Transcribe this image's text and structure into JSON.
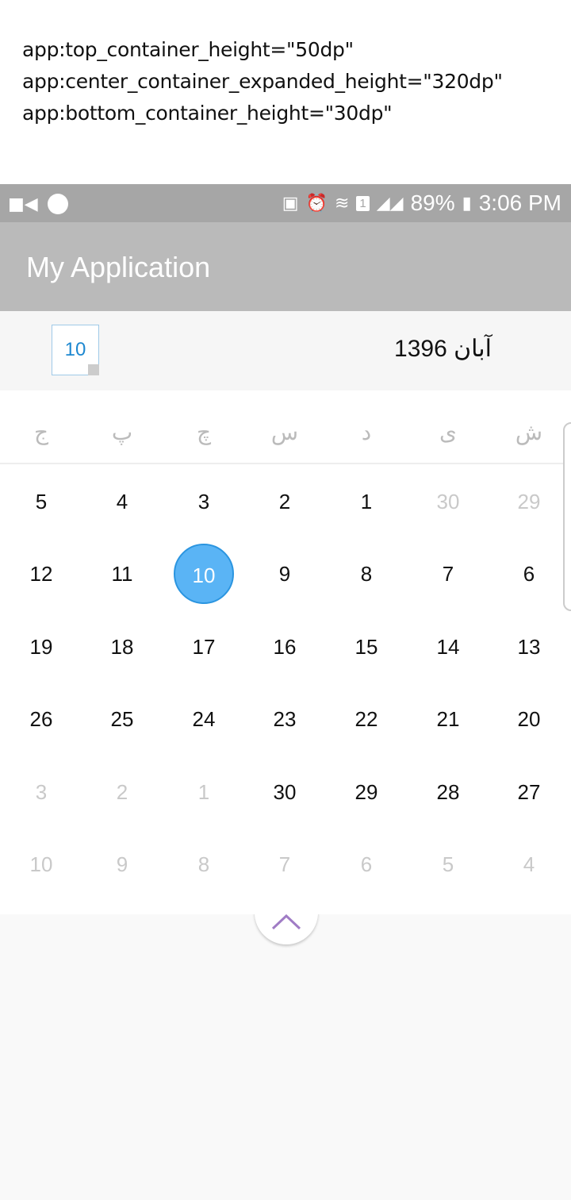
{
  "note": [
    "app:top_container_height=\"50dp\"",
    "app:center_container_expanded_height=\"320dp\"",
    "app:bottom_container_height=\"30dp\""
  ],
  "status": {
    "battery": "89%",
    "time": "3:06 PM",
    "sim": "1"
  },
  "appbar": {
    "title": "My Application"
  },
  "header": {
    "today": "10",
    "month_title": "آبان 1396"
  },
  "weekdays": [
    "ج",
    "پ",
    "چ",
    "س",
    "د",
    "ی",
    "ش"
  ],
  "rows": [
    [
      {
        "d": "5"
      },
      {
        "d": "4"
      },
      {
        "d": "3"
      },
      {
        "d": "2"
      },
      {
        "d": "1"
      },
      {
        "d": "30",
        "m": 1
      },
      {
        "d": "29",
        "m": 1
      }
    ],
    [
      {
        "d": "12"
      },
      {
        "d": "11"
      },
      {
        "d": "10",
        "sel": 1
      },
      {
        "d": "9"
      },
      {
        "d": "8"
      },
      {
        "d": "7"
      },
      {
        "d": "6"
      }
    ],
    [
      {
        "d": "19"
      },
      {
        "d": "18"
      },
      {
        "d": "17"
      },
      {
        "d": "16"
      },
      {
        "d": "15"
      },
      {
        "d": "14"
      },
      {
        "d": "13"
      }
    ],
    [
      {
        "d": "26"
      },
      {
        "d": "25"
      },
      {
        "d": "24"
      },
      {
        "d": "23"
      },
      {
        "d": "22"
      },
      {
        "d": "21"
      },
      {
        "d": "20"
      }
    ],
    [
      {
        "d": "3",
        "m": 1
      },
      {
        "d": "2",
        "m": 1
      },
      {
        "d": "1",
        "m": 1
      },
      {
        "d": "30"
      },
      {
        "d": "29"
      },
      {
        "d": "28"
      },
      {
        "d": "27"
      }
    ],
    [
      {
        "d": "10",
        "m": 1
      },
      {
        "d": "9",
        "m": 1
      },
      {
        "d": "8",
        "m": 1
      },
      {
        "d": "7",
        "m": 1
      },
      {
        "d": "6",
        "m": 1
      },
      {
        "d": "5",
        "m": 1
      },
      {
        "d": "4",
        "m": 1
      }
    ]
  ],
  "colors": {
    "selected": "#5ab4f5",
    "chevron": "#a07cc5"
  }
}
